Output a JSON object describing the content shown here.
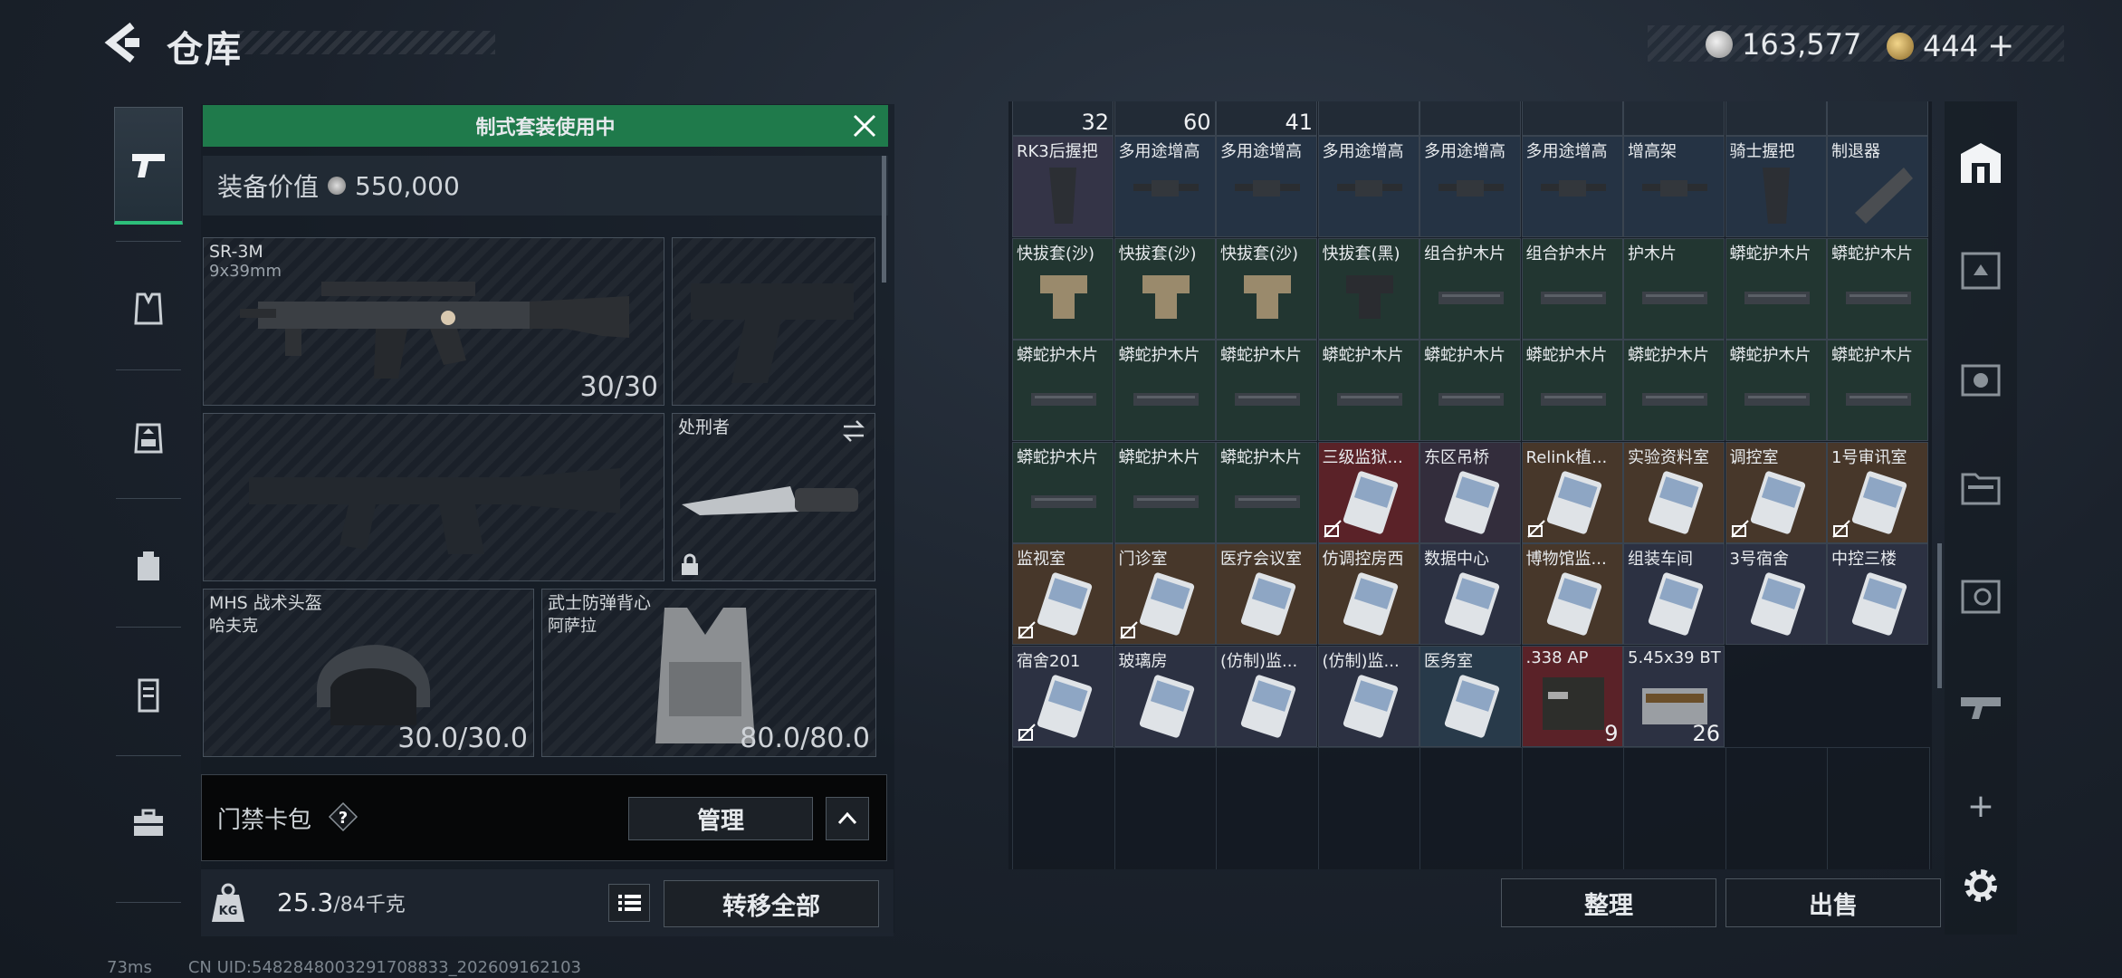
{
  "header": {
    "title": "仓库",
    "currency1": "163,577",
    "currency2": "444",
    "plus": "+"
  },
  "left_nav": {
    "items": [
      "weapon",
      "armor",
      "rig",
      "backpack",
      "container",
      "toolbox"
    ]
  },
  "equipment": {
    "banner": "制式套装使用中",
    "value_label": "装备价值",
    "value": "550,000",
    "primary": {
      "name": "SR-3M",
      "caliber": "9x39mm",
      "ammo": "30/30"
    },
    "melee": {
      "name": "处刑者"
    },
    "helmet": {
      "name": "MHS 战术头盔",
      "sub": "哈夫克",
      "durability": "30.0/30.0"
    },
    "vest": {
      "name": "武士防弹背心",
      "sub": "阿萨拉",
      "durability": "80.0/80.0"
    },
    "card_pack": "门禁卡包",
    "manage": "管理",
    "weight": "25.3",
    "weight_max": "/84千克",
    "transfer_all": "转移全部"
  },
  "storage": {
    "top_counts": [
      "32",
      "60",
      "41"
    ],
    "rows": [
      [
        {
          "name": "RK3后握把",
          "bg": "#343447"
        },
        {
          "name": "多用途增高",
          "bg": "#253344"
        },
        {
          "name": "多用途增高",
          "bg": "#253344"
        },
        {
          "name": "多用途增高",
          "bg": "#253344"
        },
        {
          "name": "多用途增高",
          "bg": "#253344"
        },
        {
          "name": "多用途增高",
          "bg": "#253344"
        },
        {
          "name": "增高架",
          "bg": "#253344"
        },
        {
          "name": "骑士握把",
          "bg": "#253344"
        },
        {
          "name": "制退器",
          "bg": "#253344"
        }
      ],
      [
        {
          "name": "快拔套(沙)",
          "bg": "#223631"
        },
        {
          "name": "快拔套(沙)",
          "bg": "#223631"
        },
        {
          "name": "快拔套(沙)",
          "bg": "#223631"
        },
        {
          "name": "快拔套(黑)",
          "bg": "#223631"
        },
        {
          "name": "组合护木片",
          "bg": "#223631"
        },
        {
          "name": "组合护木片",
          "bg": "#223631"
        },
        {
          "name": "护木片",
          "bg": "#223631"
        },
        {
          "name": "蟒蛇护木片",
          "bg": "#223631"
        },
        {
          "name": "蟒蛇护木片",
          "bg": "#223631"
        }
      ],
      [
        {
          "name": "蟒蛇护木片",
          "bg": "#223631"
        },
        {
          "name": "蟒蛇护木片",
          "bg": "#223631"
        },
        {
          "name": "蟒蛇护木片",
          "bg": "#223631"
        },
        {
          "name": "蟒蛇护木片",
          "bg": "#223631"
        },
        {
          "name": "蟒蛇护木片",
          "bg": "#223631"
        },
        {
          "name": "蟒蛇护木片",
          "bg": "#223631"
        },
        {
          "name": "蟒蛇护木片",
          "bg": "#223631"
        },
        {
          "name": "蟒蛇护木片",
          "bg": "#223631"
        },
        {
          "name": "蟒蛇护木片",
          "bg": "#223631"
        }
      ],
      [
        {
          "name": "蟒蛇护木片",
          "bg": "#223631"
        },
        {
          "name": "蟒蛇护木片",
          "bg": "#223631"
        },
        {
          "name": "蟒蛇护木片",
          "bg": "#223631"
        },
        {
          "name": "三级监狱...",
          "bg": "#5a2228",
          "nolock": true
        },
        {
          "name": "东区吊桥",
          "bg": "#332d3c"
        },
        {
          "name": "Relink植...",
          "bg": "#47372a",
          "nolock": true
        },
        {
          "name": "实验资料室",
          "bg": "#47372a"
        },
        {
          "name": "调控室",
          "bg": "#47372a",
          "nolock": true
        },
        {
          "name": "1号审讯室",
          "bg": "#47372a",
          "nolock": true
        }
      ],
      [
        {
          "name": "监视室",
          "bg": "#47372a",
          "nolock": true
        },
        {
          "name": "门诊室",
          "bg": "#47372a",
          "nolock": true
        },
        {
          "name": "医疗会议室",
          "bg": "#47372a"
        },
        {
          "name": "仿调控房西",
          "bg": "#47372a"
        },
        {
          "name": "数据中心",
          "bg": "#2c3142"
        },
        {
          "name": "博物馆监...",
          "bg": "#47372a"
        },
        {
          "name": "组装车间",
          "bg": "#2c3142"
        },
        {
          "name": "3号宿舍",
          "bg": "#2c3142"
        },
        {
          "name": "中控三楼",
          "bg": "#2c3142"
        }
      ],
      [
        {
          "name": "宿舍201",
          "bg": "#2c3142",
          "nolock": true
        },
        {
          "name": "玻璃房",
          "bg": "#2c3142"
        },
        {
          "name": "(仿制)监...",
          "bg": "#2c3142"
        },
        {
          "name": "(仿制)监...",
          "bg": "#2c3142"
        },
        {
          "name": "医务室",
          "bg": "#283a4a"
        },
        {
          "name": ".338 AP",
          "bg": "#5a2228",
          "count": "9"
        },
        {
          "name": "5.45x39 BT",
          "bg": "#2c3142",
          "count": "26"
        }
      ]
    ],
    "sort_btn": "整理",
    "sell_btn": "出售"
  },
  "right_rail": {
    "plus": "+"
  },
  "status_bar": {
    "ping": "73ms",
    "uid": "CN UID:5482848003291708833_202609162103"
  }
}
